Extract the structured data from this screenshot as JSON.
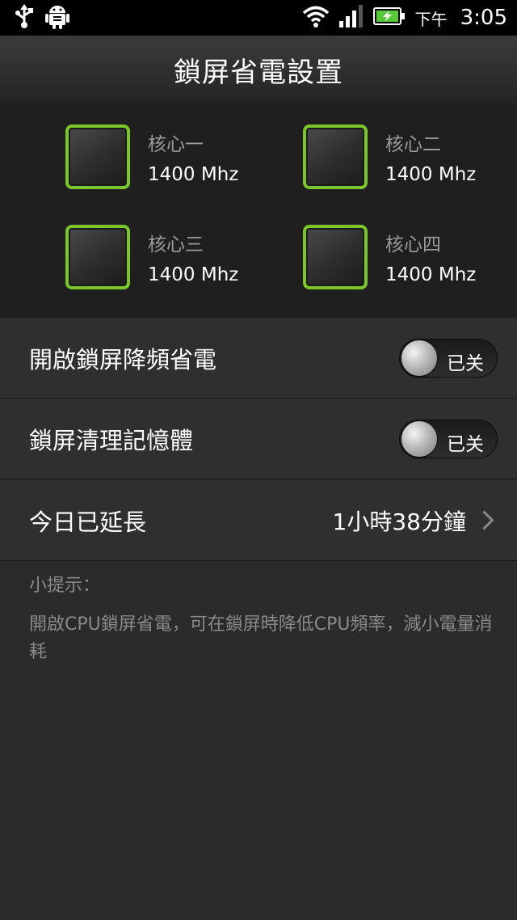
{
  "status_bar": {
    "icons": [
      "usb-icon",
      "android-debug-icon",
      "wifi-icon",
      "signal-icon",
      "battery-charging-icon"
    ],
    "ampm": "下午",
    "time": "3:05",
    "accent_green": "#7cc52b"
  },
  "header": {
    "title": "鎖屏省電設置"
  },
  "cores": [
    {
      "name": "核心一",
      "freq": "1400 Mhz"
    },
    {
      "name": "核心二",
      "freq": "1400 Mhz"
    },
    {
      "name": "核心三",
      "freq": "1400 Mhz"
    },
    {
      "name": "核心四",
      "freq": "1400 Mhz"
    }
  ],
  "settings": {
    "power_save": {
      "label": "開啟鎖屏降頻省電",
      "state": "已关"
    },
    "memory_clean": {
      "label": "鎖屏清理記憶體",
      "state": "已关"
    },
    "extended": {
      "label": "今日已延長",
      "value": "1小時38分鐘"
    }
  },
  "tips": {
    "title": "小提示：",
    "body": "開啟CPU鎖屏省電，可在鎖屏時降低CPU頻率，減小電量消耗"
  }
}
